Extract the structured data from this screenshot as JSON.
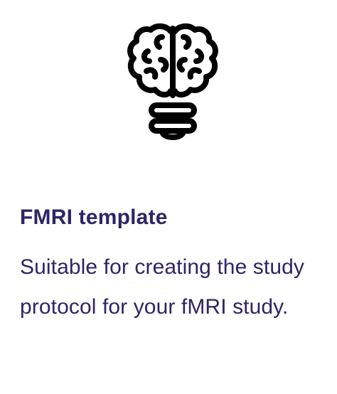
{
  "card": {
    "icon": "brain-lightbulb-icon",
    "title": "FMRI template",
    "description": "Suitable for creating the study protocol for your fMRI study."
  },
  "colors": {
    "text": "#2d2566",
    "icon": "#000000",
    "background": "#ffffff"
  }
}
